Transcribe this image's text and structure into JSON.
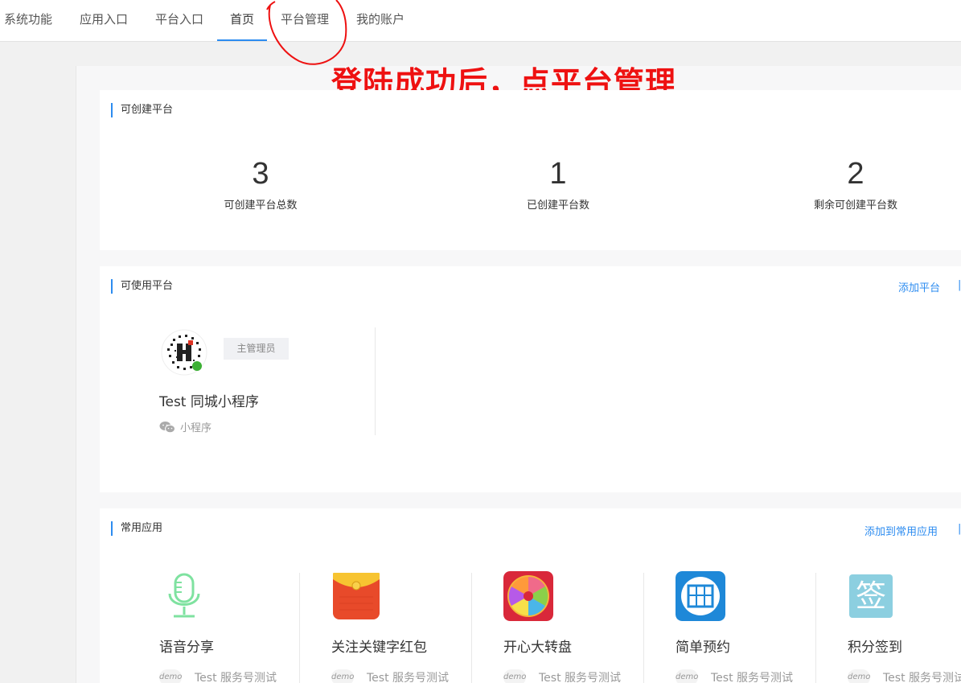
{
  "nav": {
    "tabs": [
      {
        "label": "系统功能"
      },
      {
        "label": "应用入口"
      },
      {
        "label": "平台入口"
      },
      {
        "label": "首页"
      },
      {
        "label": "平台管理"
      },
      {
        "label": "我的账户"
      }
    ],
    "active_tab": "首页",
    "accent_color": "#2d8cf0"
  },
  "annotation": {
    "text": "登陆成功后，点平台管理",
    "color": "#ee1111"
  },
  "creatable": {
    "title": "可创建平台",
    "stats": [
      {
        "value": "3",
        "label": "可创建平台总数"
      },
      {
        "value": "1",
        "label": "已创建平台数"
      },
      {
        "value": "2",
        "label": "剩余可创建平台数"
      }
    ]
  },
  "usable": {
    "title": "可使用平台",
    "add_link": "添加平台",
    "platform": {
      "role": "主管理员",
      "name": "Test 同城小程序",
      "type": "小程序",
      "icon": "wechat-icon"
    }
  },
  "common_apps": {
    "title": "常用应用",
    "add_link": "添加到常用应用",
    "apps": [
      {
        "name": "语音分享",
        "owner": "Test 服务号测试",
        "icon": "microphone-icon"
      },
      {
        "name": "关注关键字红包",
        "owner": "Test 服务号测试",
        "icon": "red-envelope-icon"
      },
      {
        "name": "开心大转盘",
        "owner": "Test 服务号测试",
        "icon": "wheel-icon"
      },
      {
        "name": "简单预约",
        "owner": "Test 服务号测试",
        "icon": "appointment-icon"
      },
      {
        "name": "积分签到",
        "owner": "Test 服务号测试",
        "icon": "signin-icon"
      }
    ],
    "owner_logo_text": "demo"
  }
}
